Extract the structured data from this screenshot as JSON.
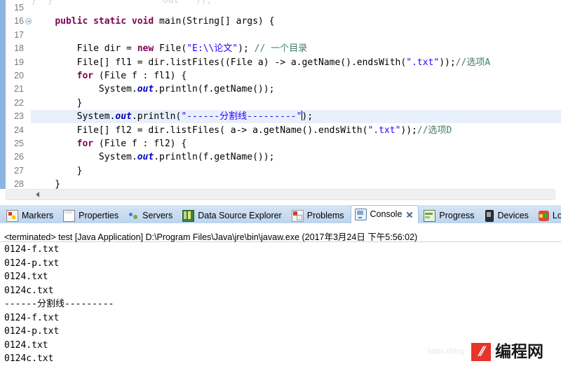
{
  "editor": {
    "ghost_line_text": "}  }                    out  \"));",
    "first_line_number": 15,
    "active_line": 23,
    "lines": [
      {
        "num": "15",
        "fold": false,
        "indent": 0,
        "tokens": []
      },
      {
        "num": "16",
        "fold": true,
        "indent": 0,
        "tokens": [
          {
            "t": "    ",
            "c": "plain"
          },
          {
            "t": "public",
            "c": "kw"
          },
          {
            "t": " ",
            "c": "plain"
          },
          {
            "t": "static",
            "c": "kw"
          },
          {
            "t": " ",
            "c": "plain"
          },
          {
            "t": "void",
            "c": "kw"
          },
          {
            "t": " main(String[] args) {",
            "c": "plain"
          }
        ]
      },
      {
        "num": "17",
        "fold": false,
        "indent": 0,
        "tokens": []
      },
      {
        "num": "18",
        "fold": false,
        "indent": 0,
        "tokens": [
          {
            "t": "        File dir = ",
            "c": "plain"
          },
          {
            "t": "new",
            "c": "kw"
          },
          {
            "t": " File(",
            "c": "plain"
          },
          {
            "t": "\"E:\\\\论文\"",
            "c": "str"
          },
          {
            "t": "); ",
            "c": "plain"
          },
          {
            "t": "// 一个目录",
            "c": "cmt"
          }
        ]
      },
      {
        "num": "19",
        "fold": false,
        "indent": 0,
        "tokens": [
          {
            "t": "        File[] fl1 = dir.listFiles((File a) -> a.getName().endsWith(",
            "c": "plain"
          },
          {
            "t": "\".txt\"",
            "c": "str"
          },
          {
            "t": "));",
            "c": "plain"
          },
          {
            "t": "//选项A",
            "c": "cmt"
          }
        ]
      },
      {
        "num": "20",
        "fold": false,
        "indent": 0,
        "tokens": [
          {
            "t": "        ",
            "c": "plain"
          },
          {
            "t": "for",
            "c": "kw"
          },
          {
            "t": " (File f : fl1) {",
            "c": "plain"
          }
        ]
      },
      {
        "num": "21",
        "fold": false,
        "indent": 0,
        "tokens": [
          {
            "t": "            System.",
            "c": "plain"
          },
          {
            "t": "out",
            "c": "fld"
          },
          {
            "t": ".println(f.getName());",
            "c": "plain"
          }
        ]
      },
      {
        "num": "22",
        "fold": false,
        "indent": 0,
        "tokens": [
          {
            "t": "        }",
            "c": "plain"
          }
        ]
      },
      {
        "num": "23",
        "fold": false,
        "indent": 0,
        "tokens": [
          {
            "t": "        System.",
            "c": "plain"
          },
          {
            "t": "out",
            "c": "fld"
          },
          {
            "t": ".println(",
            "c": "plain"
          },
          {
            "t": "\"------分割线---------\"",
            "c": "str"
          },
          {
            "t": "CARET",
            "c": "caret"
          },
          {
            "t": ");",
            "c": "plain"
          }
        ]
      },
      {
        "num": "24",
        "fold": false,
        "indent": 0,
        "tokens": [
          {
            "t": "        File[] fl2 = dir.listFiles( a-> a.getName().endsWith(",
            "c": "plain"
          },
          {
            "t": "\".txt\"",
            "c": "str"
          },
          {
            "t": "));",
            "c": "plain"
          },
          {
            "t": "//选项D",
            "c": "cmt"
          }
        ]
      },
      {
        "num": "25",
        "fold": false,
        "indent": 0,
        "tokens": [
          {
            "t": "        ",
            "c": "plain"
          },
          {
            "t": "for",
            "c": "kw"
          },
          {
            "t": " (File f : fl2) {",
            "c": "plain"
          }
        ]
      },
      {
        "num": "26",
        "fold": false,
        "indent": 0,
        "tokens": [
          {
            "t": "            System.",
            "c": "plain"
          },
          {
            "t": "out",
            "c": "fld"
          },
          {
            "t": ".println(f.getName());",
            "c": "plain"
          }
        ]
      },
      {
        "num": "27",
        "fold": false,
        "indent": 0,
        "tokens": [
          {
            "t": "        }",
            "c": "plain"
          }
        ]
      },
      {
        "num": "28",
        "fold": false,
        "indent": 0,
        "tokens": [
          {
            "t": "    }",
            "c": "plain"
          }
        ]
      }
    ]
  },
  "tabbar": {
    "tabs": [
      {
        "label": "Markers",
        "icon": "markers-icon",
        "icon_class": "ico-markers",
        "active": false,
        "closable": false
      },
      {
        "label": "Properties",
        "icon": "properties-icon",
        "icon_class": "ico-properties",
        "active": false,
        "closable": false
      },
      {
        "label": "Servers",
        "icon": "servers-icon",
        "icon_class": "ico-servers",
        "active": false,
        "closable": false
      },
      {
        "label": "Data Source Explorer",
        "icon": "database-icon",
        "icon_class": "ico-dsexplorer",
        "active": false,
        "closable": false
      },
      {
        "label": "Problems",
        "icon": "problems-icon",
        "icon_class": "ico-problems",
        "active": false,
        "closable": false
      },
      {
        "label": "Console",
        "icon": "console-icon",
        "icon_class": "ico-console",
        "active": true,
        "closable": true
      },
      {
        "label": "Progress",
        "icon": "progress-icon",
        "icon_class": "ico-progress",
        "active": false,
        "closable": false
      },
      {
        "label": "Devices",
        "icon": "devices-icon",
        "icon_class": "ico-devices",
        "active": false,
        "closable": false
      },
      {
        "label": "LogCat",
        "icon": "logcat-icon",
        "icon_class": "ico-logcat",
        "active": false,
        "closable": false
      }
    ]
  },
  "console": {
    "launch_line": "<terminated> test [Java Application] D:\\Program Files\\Java\\jre\\bin\\javaw.exe (2017年3月24日 下午5:56:02)",
    "output_lines": [
      "0124-f.txt",
      "0124-p.txt",
      "0124.txt",
      "0124c.txt",
      "------分割线---------",
      "0124-f.txt",
      "0124-p.txt",
      "0124.txt",
      "0124c.txt"
    ]
  },
  "watermark": {
    "url": "https://blog",
    "badge": "⫽",
    "text": "编程网"
  },
  "colors": {
    "keyword": "#7f0055",
    "string": "#2a00ff",
    "comment": "#3f7f5f",
    "field": "#0000c0",
    "active_line": "#e8f0fb",
    "tabbar": "#cbddf2",
    "accent_band": "#8eb4e3",
    "watermark_red": "#e8342a"
  }
}
